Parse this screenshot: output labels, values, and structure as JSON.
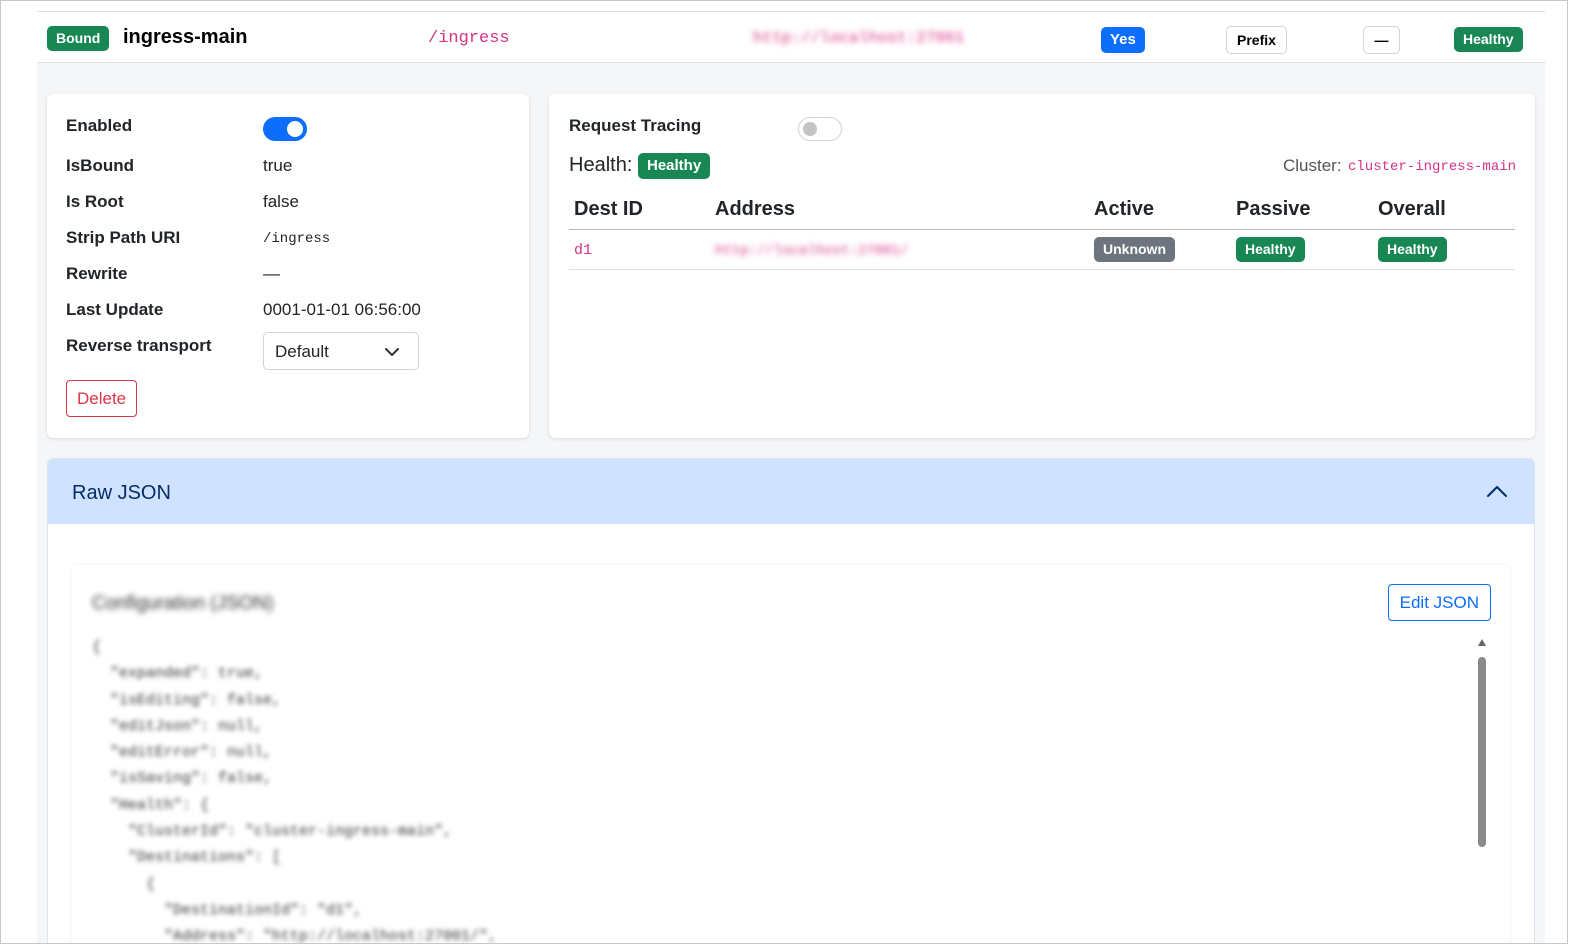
{
  "route": {
    "bound_badge": "Bound",
    "name": "ingress-main",
    "path": "/ingress",
    "address": "http://localhost:27001",
    "root_badge": "Yes",
    "match_badge": "Prefix",
    "rewrite_badge": "—",
    "health_badge": "Healthy"
  },
  "details": {
    "enabled_label": "Enabled",
    "enabled_on": true,
    "isbound_label": "IsBound",
    "isbound_value": "true",
    "isroot_label": "Is Root",
    "isroot_value": "false",
    "strip_label": "Strip Path URI",
    "strip_value": "/ingress",
    "rewrite_label": "Rewrite",
    "rewrite_value": "—",
    "last_update_label": "Last Update",
    "last_update_value": "0001-01-01 06:56:00",
    "transport_label": "Reverse transport",
    "transport_value": "Default",
    "delete_label": "Delete"
  },
  "cluster": {
    "tracing_label": "Request Tracing",
    "tracing_on": false,
    "health_label": "Health:",
    "health_badge": "Healthy",
    "cluster_label": "Cluster:",
    "cluster_value": "cluster-ingress-main",
    "columns": [
      "Dest ID",
      "Address",
      "Active",
      "Passive",
      "Overall"
    ],
    "rows": [
      {
        "id": "d1",
        "address": "http://localhost:27001/",
        "active": "Unknown",
        "passive": "Healthy",
        "overall": "Healthy"
      }
    ]
  },
  "raw_json": {
    "header": "Raw JSON",
    "card_title": "Configuration (JSON)",
    "edit_label": "Edit JSON",
    "lines": "{\n  \"expanded\": true,\n  \"isEditing\": false,\n  \"editJson\": null,\n  \"editError\": null,\n  \"isSaving\": false,\n  \"Health\": {\n    \"ClusterId\": \"cluster-ingress-main\",\n    \"Destinations\": [\n      {\n        \"DestinationId\": \"d1\",\n        \"Address\": \"http://localhost:27001/\","
  },
  "colors": {
    "green": "#198754",
    "blue": "#0d6efd",
    "gray": "#6c757d",
    "pink": "#d63384",
    "accordion": "#cfe2ff"
  }
}
